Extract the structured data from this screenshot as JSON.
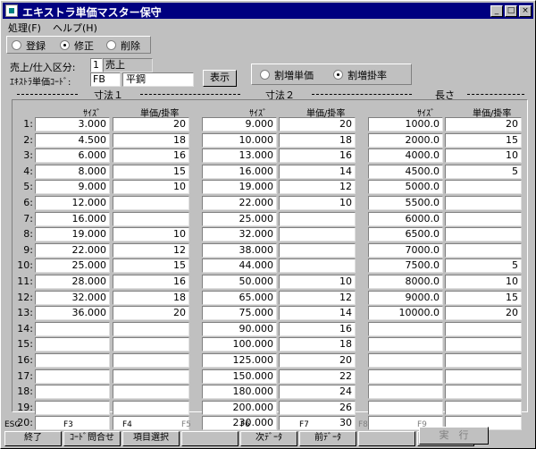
{
  "window": {
    "title": "エキストラ単価マスター保守"
  },
  "menu": [
    {
      "label": "処理(F)"
    },
    {
      "label": "ヘルプ(H)"
    }
  ],
  "mode": {
    "options": [
      {
        "label": "登録"
      },
      {
        "label": "修正"
      },
      {
        "label": "削除"
      }
    ],
    "selected": 1
  },
  "form": {
    "category_label": "売上/仕入区分:",
    "category_code": "1",
    "category_name": "売上",
    "code_label": "ｴｷｽﾄﾗ単価ｺｰﾄﾞ:",
    "code_value": "FB",
    "code_name": "平鋼",
    "show_button": "表示"
  },
  "calc": {
    "options": [
      {
        "label": "割増単価"
      },
      {
        "label": "割増掛率"
      }
    ],
    "selected": 1
  },
  "sections": [
    {
      "title": "寸法１"
    },
    {
      "title": "寸法２"
    },
    {
      "title": "長さ"
    }
  ],
  "columns": {
    "size": "ｻｲｽﾞ",
    "rate": "単価/掛率"
  },
  "row_labels": [
    "1:",
    "2:",
    "3:",
    "4:",
    "5:",
    "6:",
    "7:",
    "8:",
    "9:",
    "10:",
    "11:",
    "12:",
    "13:",
    "14:",
    "15:",
    "16:",
    "17:",
    "18:",
    "19:",
    "20:"
  ],
  "dim1": {
    "size": [
      "3.000",
      "4.500",
      "6.000",
      "8.000",
      "9.000",
      "12.000",
      "16.000",
      "19.000",
      "22.000",
      "25.000",
      "28.000",
      "32.000",
      "36.000",
      "",
      "",
      "",
      "",
      "",
      "",
      ""
    ],
    "rate": [
      "20",
      "18",
      "16",
      "15",
      "10",
      "",
      "",
      "10",
      "12",
      "15",
      "16",
      "18",
      "20",
      "",
      "",
      "",
      "",
      "",
      "",
      ""
    ]
  },
  "dim2": {
    "size": [
      "9.000",
      "10.000",
      "13.000",
      "16.000",
      "19.000",
      "22.000",
      "25.000",
      "32.000",
      "38.000",
      "44.000",
      "50.000",
      "65.000",
      "75.000",
      "90.000",
      "100.000",
      "125.000",
      "150.000",
      "180.000",
      "200.000",
      "230.000"
    ],
    "rate": [
      "20",
      "18",
      "16",
      "14",
      "12",
      "10",
      "",
      "",
      "",
      "",
      "10",
      "12",
      "14",
      "16",
      "18",
      "20",
      "22",
      "24",
      "26",
      "30"
    ]
  },
  "length": {
    "size": [
      "1000.0",
      "2000.0",
      "4000.0",
      "4500.0",
      "5000.0",
      "5500.0",
      "6000.0",
      "6500.0",
      "7000.0",
      "7500.0",
      "8000.0",
      "9000.0",
      "10000.0",
      "",
      "",
      "",
      "",
      "",
      "",
      ""
    ],
    "rate": [
      "20",
      "15",
      "10",
      "5",
      "",
      "",
      "",
      "",
      "",
      "5",
      "10",
      "15",
      "20",
      "",
      "",
      "",
      "",
      "",
      "",
      ""
    ]
  },
  "fkeys": [
    {
      "key": "ESC",
      "label": "終了",
      "enabled": true
    },
    {
      "key": "F3",
      "label": "ｺｰﾄﾞ問合せ",
      "enabled": true
    },
    {
      "key": "F4",
      "label": "項目選択",
      "enabled": true
    },
    {
      "key": "F5",
      "label": "",
      "enabled": false
    },
    {
      "key": "F6",
      "label": "次ﾃﾞｰﾀ",
      "enabled": true
    },
    {
      "key": "F7",
      "label": "前ﾃﾞｰﾀ",
      "enabled": true
    },
    {
      "key": "F8",
      "label": "",
      "enabled": false
    },
    {
      "key": "F9",
      "label": "",
      "enabled": false
    }
  ],
  "execute_button": "実　行",
  "colors": {
    "titlebar": "#000080",
    "face": "#c0c0c0",
    "field": "#ffffff"
  }
}
